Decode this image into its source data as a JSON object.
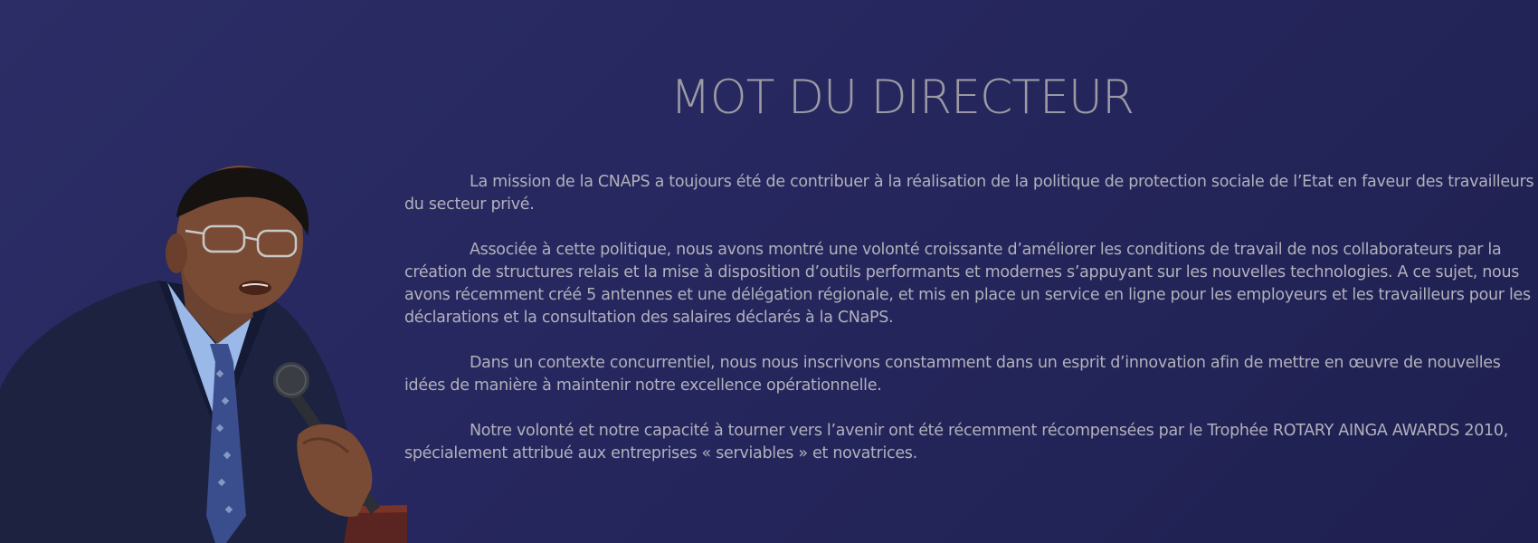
{
  "title": "MOT DU DIRECTEUR",
  "paragraphs": [
    "La mission de la CNAPS a toujours été de contribuer à la réalisation de la politique de protection sociale de l’Etat en faveur des travailleurs du secteur privé.",
    "Associée à cette politique, nous avons montré une volonté croissante d’améliorer les conditions de travail de nos collaborateurs par la création de structures relais et la mise à disposition d’outils performants et modernes s’appuyant sur les nouvelles technologies. A ce sujet, nous avons récemment créé 5 antennes et une délégation régionale, et mis en place un service en ligne pour les employeurs et les travailleurs pour les déclarations et la consultation des salaires déclarés à la CNaPS.",
    "Dans un contexte concurrentiel, nous nous inscrivons constamment dans un esprit d’innovation afin de mettre en œuvre de nouvelles idées de manière à maintenir notre excellence opérationnelle.",
    "Notre volonté et notre capacité à tourner vers l’avenir ont été récemment récompensées par le Trophée ROTARY AINGA AWARDS 2010, spécialement attribué aux entreprises « serviables » et novatrices."
  ],
  "colors": {
    "background": "#2a2b62",
    "title": "#9b9aa4",
    "text": "#b2b1bc"
  },
  "image": {
    "subject": "director-speaking-at-podium-with-microphone"
  }
}
